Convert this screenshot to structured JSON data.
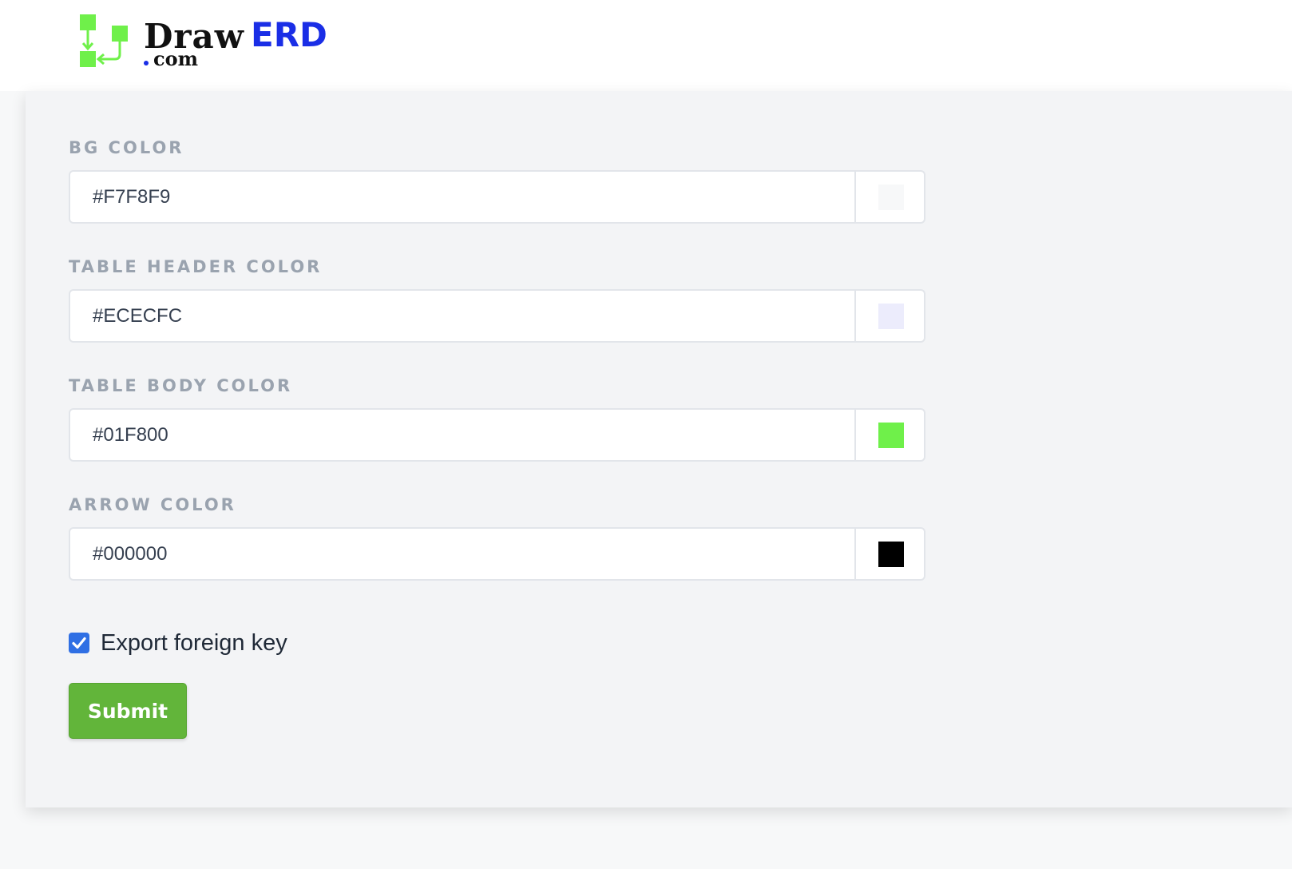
{
  "logo": {
    "draw": "Draw",
    "erd": "ERD",
    "com": "com"
  },
  "form": {
    "fields": [
      {
        "label": "BG COLOR",
        "value": "#F7F8F9",
        "swatch": "#F7F8F9"
      },
      {
        "label": "TABLE HEADER COLOR",
        "value": "#ECECFC",
        "swatch": "#ECECFC"
      },
      {
        "label": "TABLE BODY COLOR",
        "value": "#01F800",
        "swatch": "#6FF04A"
      },
      {
        "label": "ARROW COLOR",
        "value": "#000000",
        "swatch": "#000000"
      }
    ],
    "export_fk": {
      "label": "Export foreign key",
      "checked": true
    },
    "submit_label": "Submit"
  },
  "colors": {
    "logo_green": "#6FF04A",
    "logo_blue": "#1A2EE6",
    "submit_green": "#62B53A",
    "checkbox_blue": "#2F6FE4"
  }
}
